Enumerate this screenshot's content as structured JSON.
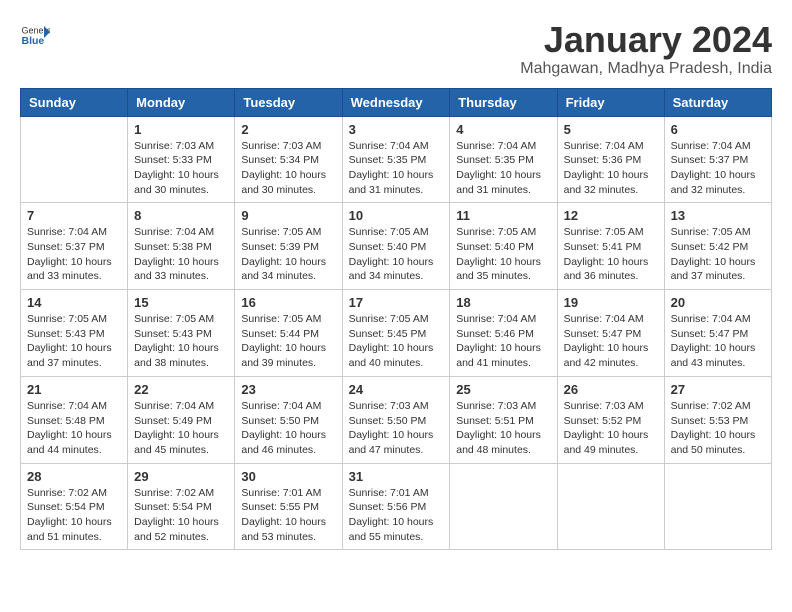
{
  "header": {
    "logo_line1": "General",
    "logo_line2": "Blue",
    "month": "January 2024",
    "location": "Mahgawan, Madhya Pradesh, India"
  },
  "days_of_week": [
    "Sunday",
    "Monday",
    "Tuesday",
    "Wednesday",
    "Thursday",
    "Friday",
    "Saturday"
  ],
  "weeks": [
    [
      {
        "day": "",
        "info": ""
      },
      {
        "day": "1",
        "info": "Sunrise: 7:03 AM\nSunset: 5:33 PM\nDaylight: 10 hours\nand 30 minutes."
      },
      {
        "day": "2",
        "info": "Sunrise: 7:03 AM\nSunset: 5:34 PM\nDaylight: 10 hours\nand 30 minutes."
      },
      {
        "day": "3",
        "info": "Sunrise: 7:04 AM\nSunset: 5:35 PM\nDaylight: 10 hours\nand 31 minutes."
      },
      {
        "day": "4",
        "info": "Sunrise: 7:04 AM\nSunset: 5:35 PM\nDaylight: 10 hours\nand 31 minutes."
      },
      {
        "day": "5",
        "info": "Sunrise: 7:04 AM\nSunset: 5:36 PM\nDaylight: 10 hours\nand 32 minutes."
      },
      {
        "day": "6",
        "info": "Sunrise: 7:04 AM\nSunset: 5:37 PM\nDaylight: 10 hours\nand 32 minutes."
      }
    ],
    [
      {
        "day": "7",
        "info": "Sunrise: 7:04 AM\nSunset: 5:37 PM\nDaylight: 10 hours\nand 33 minutes."
      },
      {
        "day": "8",
        "info": "Sunrise: 7:04 AM\nSunset: 5:38 PM\nDaylight: 10 hours\nand 33 minutes."
      },
      {
        "day": "9",
        "info": "Sunrise: 7:05 AM\nSunset: 5:39 PM\nDaylight: 10 hours\nand 34 minutes."
      },
      {
        "day": "10",
        "info": "Sunrise: 7:05 AM\nSunset: 5:40 PM\nDaylight: 10 hours\nand 34 minutes."
      },
      {
        "day": "11",
        "info": "Sunrise: 7:05 AM\nSunset: 5:40 PM\nDaylight: 10 hours\nand 35 minutes."
      },
      {
        "day": "12",
        "info": "Sunrise: 7:05 AM\nSunset: 5:41 PM\nDaylight: 10 hours\nand 36 minutes."
      },
      {
        "day": "13",
        "info": "Sunrise: 7:05 AM\nSunset: 5:42 PM\nDaylight: 10 hours\nand 37 minutes."
      }
    ],
    [
      {
        "day": "14",
        "info": "Sunrise: 7:05 AM\nSunset: 5:43 PM\nDaylight: 10 hours\nand 37 minutes."
      },
      {
        "day": "15",
        "info": "Sunrise: 7:05 AM\nSunset: 5:43 PM\nDaylight: 10 hours\nand 38 minutes."
      },
      {
        "day": "16",
        "info": "Sunrise: 7:05 AM\nSunset: 5:44 PM\nDaylight: 10 hours\nand 39 minutes."
      },
      {
        "day": "17",
        "info": "Sunrise: 7:05 AM\nSunset: 5:45 PM\nDaylight: 10 hours\nand 40 minutes."
      },
      {
        "day": "18",
        "info": "Sunrise: 7:04 AM\nSunset: 5:46 PM\nDaylight: 10 hours\nand 41 minutes."
      },
      {
        "day": "19",
        "info": "Sunrise: 7:04 AM\nSunset: 5:47 PM\nDaylight: 10 hours\nand 42 minutes."
      },
      {
        "day": "20",
        "info": "Sunrise: 7:04 AM\nSunset: 5:47 PM\nDaylight: 10 hours\nand 43 minutes."
      }
    ],
    [
      {
        "day": "21",
        "info": "Sunrise: 7:04 AM\nSunset: 5:48 PM\nDaylight: 10 hours\nand 44 minutes."
      },
      {
        "day": "22",
        "info": "Sunrise: 7:04 AM\nSunset: 5:49 PM\nDaylight: 10 hours\nand 45 minutes."
      },
      {
        "day": "23",
        "info": "Sunrise: 7:04 AM\nSunset: 5:50 PM\nDaylight: 10 hours\nand 46 minutes."
      },
      {
        "day": "24",
        "info": "Sunrise: 7:03 AM\nSunset: 5:50 PM\nDaylight: 10 hours\nand 47 minutes."
      },
      {
        "day": "25",
        "info": "Sunrise: 7:03 AM\nSunset: 5:51 PM\nDaylight: 10 hours\nand 48 minutes."
      },
      {
        "day": "26",
        "info": "Sunrise: 7:03 AM\nSunset: 5:52 PM\nDaylight: 10 hours\nand 49 minutes."
      },
      {
        "day": "27",
        "info": "Sunrise: 7:02 AM\nSunset: 5:53 PM\nDaylight: 10 hours\nand 50 minutes."
      }
    ],
    [
      {
        "day": "28",
        "info": "Sunrise: 7:02 AM\nSunset: 5:54 PM\nDaylight: 10 hours\nand 51 minutes."
      },
      {
        "day": "29",
        "info": "Sunrise: 7:02 AM\nSunset: 5:54 PM\nDaylight: 10 hours\nand 52 minutes."
      },
      {
        "day": "30",
        "info": "Sunrise: 7:01 AM\nSunset: 5:55 PM\nDaylight: 10 hours\nand 53 minutes."
      },
      {
        "day": "31",
        "info": "Sunrise: 7:01 AM\nSunset: 5:56 PM\nDaylight: 10 hours\nand 55 minutes."
      },
      {
        "day": "",
        "info": ""
      },
      {
        "day": "",
        "info": ""
      },
      {
        "day": "",
        "info": ""
      }
    ]
  ]
}
